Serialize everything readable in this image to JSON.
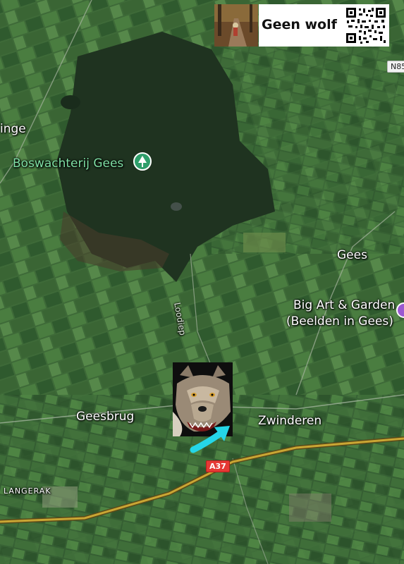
{
  "map": {
    "labels": {
      "forest": "Boswachterij Gees",
      "village_gees": "Gees",
      "poi_art_line1": "Big Art & Garden",
      "poi_art_line2": "(Beelden in Gees)",
      "geesbrug": "Geesbrug",
      "zwinderen": "Zwinderen",
      "langerak": "LANGERAK",
      "road_loodiep": "Loodiep",
      "partial_left": "inge"
    },
    "road_shields": {
      "a37": "A37",
      "n85": "N85"
    },
    "colors": {
      "forest": "#1f3320",
      "fields": "#3f6b39",
      "highway": "#c9a634",
      "poi_green": "#2e9e6a",
      "poi_purple": "#9b59d0",
      "arrow": "#25d6e8"
    }
  },
  "overlay": {
    "title": "Geen wolf",
    "icons": {
      "qr": "qr-code-icon",
      "photo": "forest-path-photo",
      "wolf": "wolf-photo",
      "arrow": "pointer-arrow-icon"
    }
  }
}
